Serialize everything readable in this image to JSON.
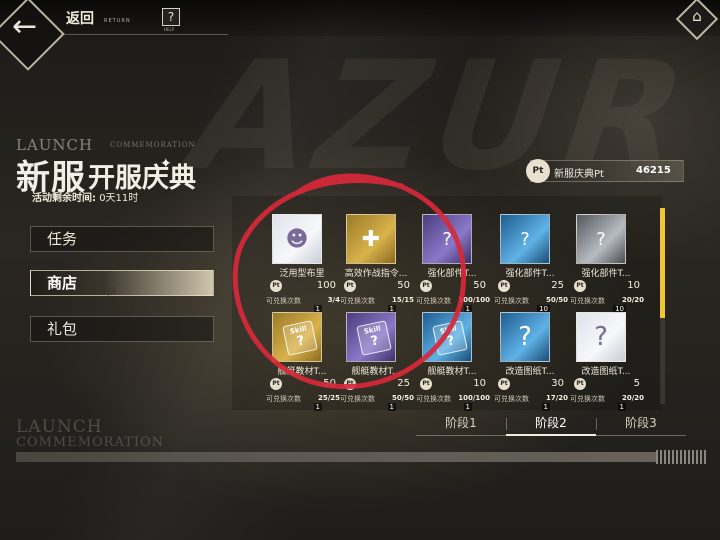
{
  "topbar": {
    "back_label": "返回",
    "back_sub": "RETURN",
    "help_glyph": "?",
    "help_sub": "HELP",
    "back_icon": "arrow-left-icon",
    "home_icon": "home-icon",
    "help_icon": "help-icon"
  },
  "event": {
    "launch_en": "LAUNCH",
    "launch_en_sub": "COMMEMORATION",
    "title_big": "新服",
    "title_small": "开服庆典",
    "time_label": "活动剩余时间:",
    "time_value": "0天11时"
  },
  "menu": {
    "items": [
      {
        "label": "任务"
      },
      {
        "label": "商店",
        "watermark": "Shop"
      },
      {
        "label": "礼包"
      }
    ],
    "active": "商店"
  },
  "points": {
    "icon_text": "Pt",
    "label": "新服庆典Pt",
    "value": "46215"
  },
  "items": [
    {
      "name": "泛用型布里",
      "price": "100",
      "limit_label": "可兑换次数",
      "limit": "3/4",
      "qty": "1",
      "icon": "bulin-avatar-icon",
      "color": "white"
    },
    {
      "name": "高效作战指令...",
      "price": "50",
      "limit_label": "可兑换次数",
      "limit": "15/15",
      "qty": "1",
      "icon": "command-book-icon",
      "color": "gold"
    },
    {
      "name": "强化部件T...",
      "price": "50",
      "limit_label": "可兑换次数",
      "limit": "100/100",
      "qty": "1",
      "icon": "upgrade-part-icon",
      "color": "purple"
    },
    {
      "name": "强化部件T...",
      "price": "25",
      "limit_label": "可兑换次数",
      "limit": "50/50",
      "qty": "10",
      "icon": "upgrade-part-icon",
      "color": "blue"
    },
    {
      "name": "强化部件T...",
      "price": "10",
      "limit_label": "可兑换次数",
      "limit": "20/20",
      "qty": "10",
      "icon": "upgrade-part-icon",
      "color": "gray"
    },
    {
      "name": "舰艇教材T...",
      "price": "50",
      "limit_label": "可兑换次数",
      "limit": "25/25",
      "qty": "1",
      "icon": "skill-book-icon",
      "color": "gold"
    },
    {
      "name": "舰艇教材T...",
      "price": "25",
      "limit_label": "可兑换次数",
      "limit": "50/50",
      "qty": "1",
      "icon": "skill-book-icon",
      "color": "purple"
    },
    {
      "name": "舰艇教材T...",
      "price": "10",
      "limit_label": "可兑换次数",
      "limit": "100/100",
      "qty": "1",
      "icon": "skill-book-icon",
      "color": "blue"
    },
    {
      "name": "改造图纸T...",
      "price": "30",
      "limit_label": "可兑换次数",
      "limit": "17/20",
      "qty": "1",
      "icon": "blueprint-icon",
      "color": "blue"
    },
    {
      "name": "改造图纸T...",
      "price": "5",
      "limit_label": "可兑换次数",
      "limit": "20/20",
      "qty": "1",
      "icon": "blueprint-icon",
      "color": "white"
    }
  ],
  "card_texts": {
    "skill": "Skill",
    "q": "?"
  },
  "stages": {
    "tabs": [
      "阶段1",
      "阶段2",
      "阶段3"
    ],
    "active": "阶段2"
  },
  "annotation": {
    "color": "#d8283a"
  }
}
